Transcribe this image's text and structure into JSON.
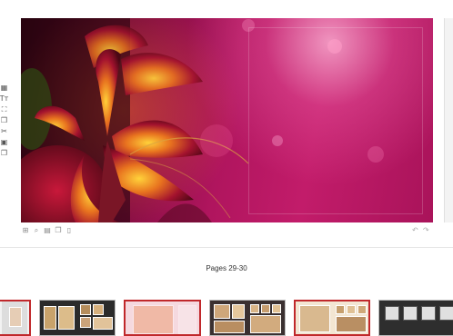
{
  "editor": {
    "left_tools": [
      {
        "icon": "grid-icon",
        "glyph": "▦"
      },
      {
        "icon": "text-icon",
        "glyph": "Tт"
      },
      {
        "icon": "crop-icon",
        "glyph": "⛶"
      },
      {
        "icon": "layers-icon",
        "glyph": "❒"
      },
      {
        "icon": "clipart-icon",
        "glyph": "✂"
      },
      {
        "icon": "frame-icon",
        "glyph": "▣"
      },
      {
        "icon": "copy-icon",
        "glyph": "❐"
      }
    ],
    "canvas_tools": [
      {
        "icon": "grid-toggle-icon",
        "glyph": "⊞"
      },
      {
        "icon": "zoom-icon",
        "glyph": "⌕"
      },
      {
        "icon": "page-icon",
        "glyph": "▤"
      },
      {
        "icon": "duplicate-icon",
        "glyph": "❐"
      },
      {
        "icon": "delete-icon",
        "glyph": "▯"
      }
    ],
    "undo_tools": [
      {
        "icon": "undo-icon",
        "glyph": "↶"
      },
      {
        "icon": "redo-icon",
        "glyph": "↷"
      }
    ]
  },
  "pages": {
    "label": "Pages 29-30"
  },
  "colors": {
    "accent_red": "#c0282b",
    "canvas_magenta": "#b0155e"
  }
}
